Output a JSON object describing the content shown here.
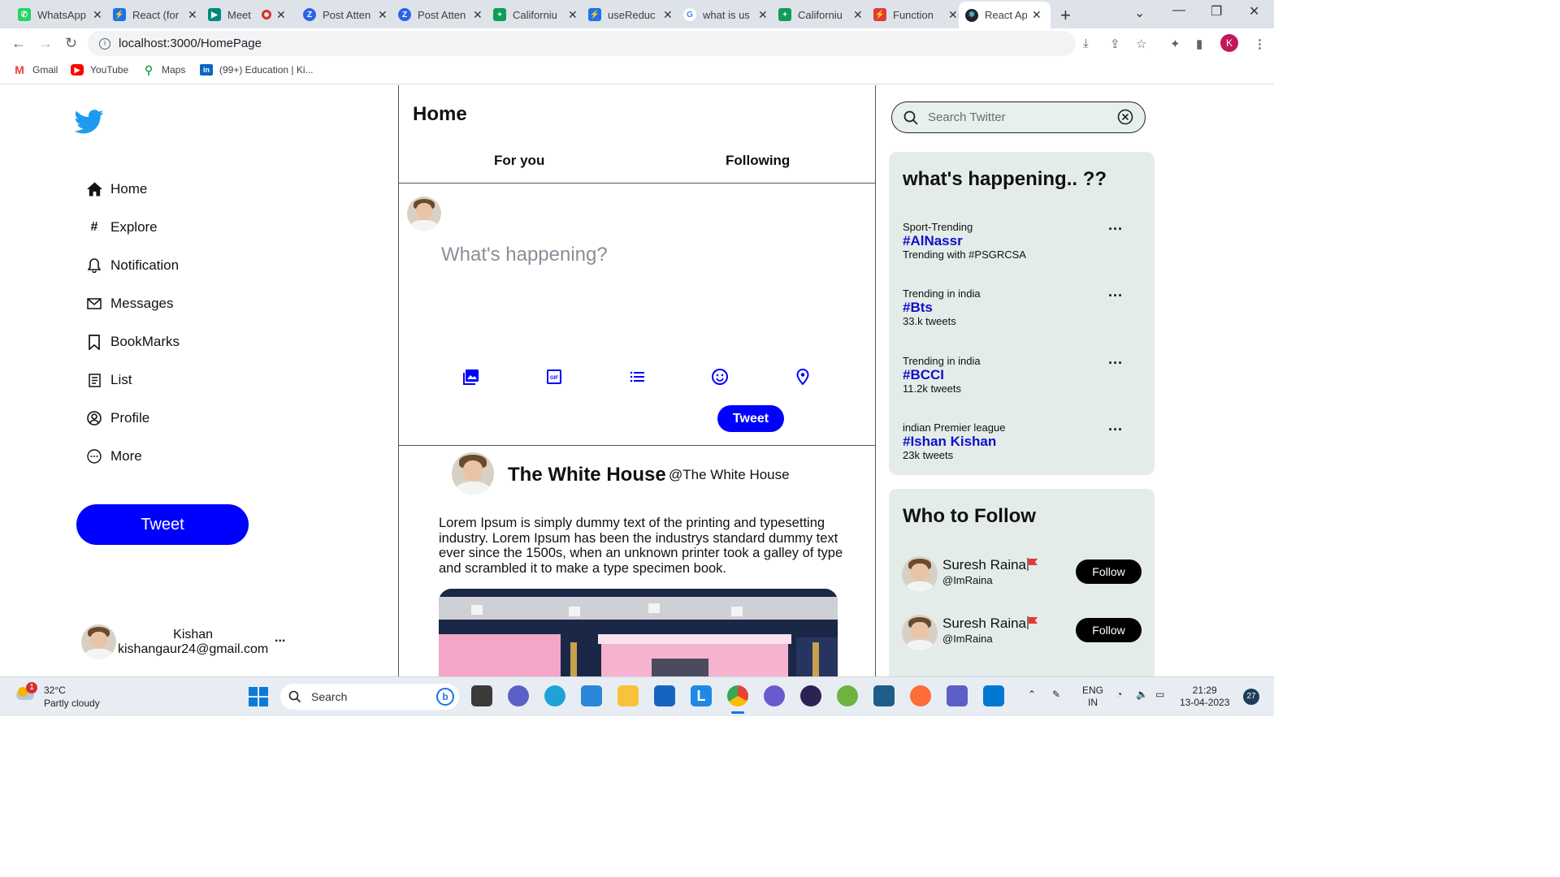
{
  "browser": {
    "tabs": [
      {
        "label": "WhatsApp",
        "color": "#25d366"
      },
      {
        "label": "React (for",
        "color": "#1a73e8"
      },
      {
        "label": "Meet",
        "color": "#00897b"
      },
      {
        "label": "Post Atten",
        "color": "#2d63ea"
      },
      {
        "label": "Post Atten",
        "color": "#2d63ea"
      },
      {
        "label": "Californiu",
        "color": "#0f9d58"
      },
      {
        "label": "useReduc",
        "color": "#1a73e8"
      },
      {
        "label": "what is us",
        "color": "#4285f4"
      },
      {
        "label": "Californiu",
        "color": "#0f9d58"
      },
      {
        "label": "Function",
        "color": "#e53935"
      },
      {
        "label": "React App",
        "color": "#20232a"
      }
    ],
    "url": "localhost:3000/HomePage",
    "profile_initial": "K",
    "bookmarks": [
      {
        "label": "Gmail"
      },
      {
        "label": "YouTube"
      },
      {
        "label": "Maps"
      },
      {
        "label": "(99+) Education | Ki..."
      }
    ]
  },
  "sidebar": {
    "nav": [
      {
        "label": "Home",
        "icon": "home-icon"
      },
      {
        "label": "Explore",
        "icon": "hashtag-icon"
      },
      {
        "label": "Notification",
        "icon": "bell-icon"
      },
      {
        "label": "Messages",
        "icon": "mail-icon"
      },
      {
        "label": "BookMarks",
        "icon": "bookmark-icon"
      },
      {
        "label": "List",
        "icon": "list-icon"
      },
      {
        "label": "Profile",
        "icon": "profile-icon"
      },
      {
        "label": "More",
        "icon": "more-icon"
      }
    ],
    "tweet_label": "Tweet",
    "user": {
      "name": "Kishan",
      "email": "kishangaur24@gmail.com",
      "menu": "..."
    }
  },
  "main": {
    "title": "Home",
    "tabs": [
      "For you",
      "Following"
    ],
    "composer": {
      "placeholder": "What's happening?",
      "tweet_label": "Tweet"
    },
    "post": {
      "name": "The White House",
      "handle": "@The White House",
      "text": "Lorem Ipsum is simply dummy text of the printing and typesetting industry. Lorem Ipsum has been the industrys standard dummy text ever since the 1500s, when an unknown printer took a galley of type and scrambled it to make a type specimen book."
    }
  },
  "right": {
    "search_placeholder": "Search Twitter",
    "trends_title": "what's happening.. ??",
    "trends": [
      {
        "category": "Sport-Trending",
        "tag": "#AlNassr",
        "meta": "Trending with #PSGRCSA"
      },
      {
        "category": "Trending in india",
        "tag": "#Bts",
        "meta": "33.k tweets"
      },
      {
        "category": "Trending in india",
        "tag": "#BCCI",
        "meta": "11.2k tweets"
      },
      {
        "category": "indian Premier league",
        "tag": "#Ishan Kishan",
        "meta": "23k tweets"
      }
    ],
    "follow_title": "Who to Follow",
    "follow": [
      {
        "name": "Suresh Raina",
        "handle": "@ImRaina",
        "button": "Follow"
      },
      {
        "name": "Suresh Raina",
        "handle": "@ImRaina",
        "button": "Follow"
      }
    ]
  },
  "taskbar": {
    "weather_temp": "32°C",
    "weather_desc": "Partly cloudy",
    "weather_badge": "1",
    "search_label": "Search",
    "lang_top": "ENG",
    "lang_bottom": "IN",
    "time": "21:29",
    "date": "13-04-2023",
    "notif_count": "27"
  },
  "colors": {
    "brand_blue": "#0000ff",
    "twitter_logo": "#1d9bf0",
    "card_bg": "#e3ece9"
  }
}
